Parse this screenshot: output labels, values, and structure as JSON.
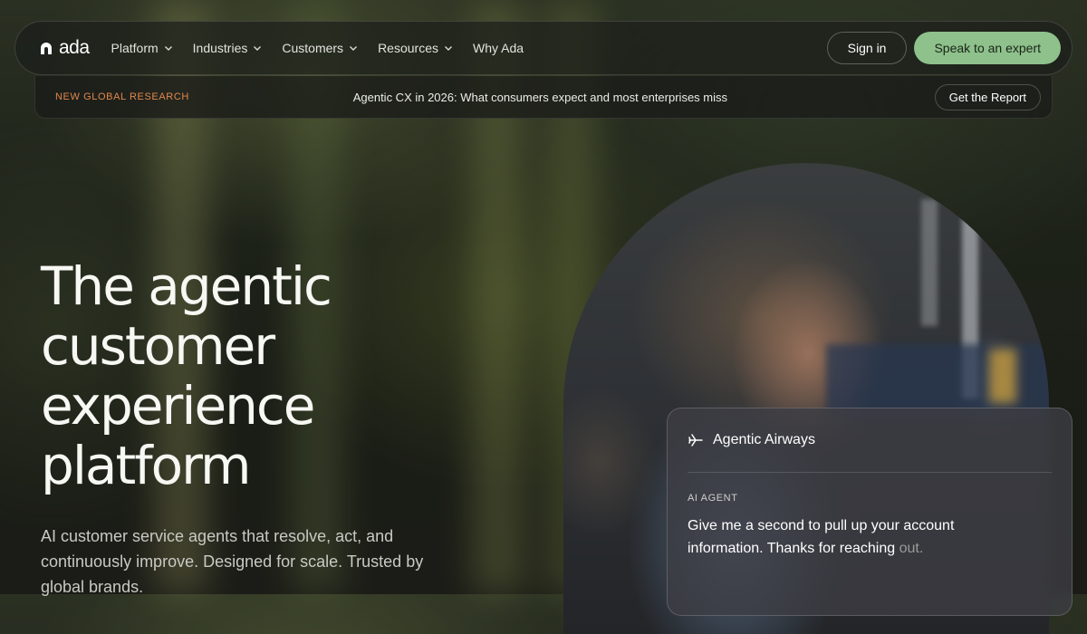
{
  "nav": {
    "logo_text": "ada",
    "menu": [
      {
        "label": "Platform",
        "dropdown": true
      },
      {
        "label": "Industries",
        "dropdown": true
      },
      {
        "label": "Customers",
        "dropdown": true
      },
      {
        "label": "Resources",
        "dropdown": true
      },
      {
        "label": "Why Ada",
        "dropdown": false
      }
    ],
    "signin_label": "Sign in",
    "cta_label": "Speak to an expert"
  },
  "banner": {
    "tag": "NEW GLOBAL RESEARCH",
    "text": "Agentic CX in 2026: What consumers expect and most enterprises miss",
    "button_label": "Get the Report"
  },
  "hero": {
    "title": "The agentic customer experience platform",
    "subtitle": "AI customer service agents that resolve, act, and continuously improve. Designed for scale. Trusted by global brands."
  },
  "chat": {
    "brand": "Agentic Airways",
    "role": "AI AGENT",
    "message": "Give me a second to pull up your account information. Thanks for reaching ",
    "message_fade": "out."
  },
  "colors": {
    "accent": "#8ec18b",
    "tag": "#e0884e"
  },
  "icons": [
    "ada-logo-icon",
    "chevron-down-icon",
    "airplane-icon"
  ]
}
